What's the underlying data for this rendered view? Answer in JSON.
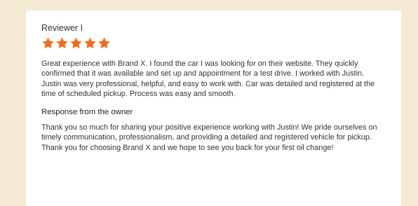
{
  "review": {
    "reviewer_name": "Reviewer I",
    "rating": 5,
    "max_rating": 5,
    "star_color": "#f26b1d",
    "text": "Great experience with Brand X. I found the car I was looking for on their website. They quickly confirmed that it was available and set up and appointment for a test drive. I worked with Justin. Justin was very professional, helpful, and easy to work with. Car was detailed and registered at the time of scheduled pickup. Process was easy and smooth."
  },
  "response": {
    "heading": "Response from the owner",
    "text": "Thank you so much for sharing your positive experience working with Justin! We pride ourselves on timely communication, professionalism, and providing a detailed and registered vehicle for pickup. Thank you for choosing Brand X and we hope to see you back for your first oil change!"
  },
  "colors": {
    "page_background": "#f4ead3",
    "card_background": "#ffffff",
    "text": "#333333"
  },
  "icons": [
    "star-icon"
  ]
}
